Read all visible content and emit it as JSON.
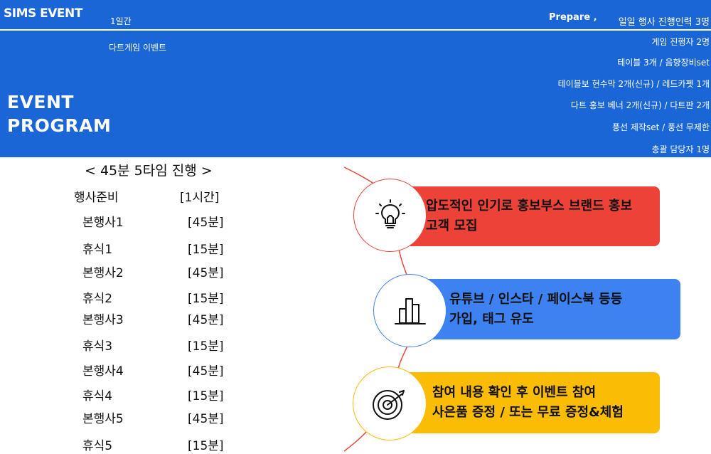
{
  "header": {
    "logo": "SIMS EVENT",
    "duration": "1일간",
    "event_name": "다트게임 이벤트",
    "prepare_label": "Prepare ,",
    "prep_items": [
      "일일 행사 진행인력 3명",
      "게임 진행자 2명",
      "테이블 3개 / 음향장비set",
      "테이블보 현수막 2개(신규) / 레드카펫 1개",
      "다트 홍보 베너 2개(신규) / 다트판 2개",
      "풍선 제작set / 풍선 무제한",
      "총괄 담당자 1명"
    ],
    "title_line1": "EVENT",
    "title_line2": "PROGRAM"
  },
  "schedule": {
    "title": "< 45분 5타임 진행 >",
    "rows": [
      {
        "name": "행사준비",
        "time": "[1시간]"
      },
      {
        "name": "본행사1",
        "time": "[45분]"
      },
      {
        "name": "휴식1",
        "time": "[15분]"
      },
      {
        "name": "본행사2",
        "time": "[45분]"
      },
      {
        "name": "휴식2",
        "time": "[15분]"
      },
      {
        "name": "본행사3",
        "time": "[45분]"
      },
      {
        "name": "휴식3",
        "time": "[15분]"
      },
      {
        "name": "본행사4",
        "time": "[45분]"
      },
      {
        "name": "휴식4",
        "time": "[15분]"
      },
      {
        "name": "본행사5",
        "time": "[45분]"
      },
      {
        "name": "휴식5",
        "time": "[15분]"
      }
    ]
  },
  "steps": [
    {
      "icon": "lightbulb-icon",
      "line1": "압도적인 인기로 홍보부스 브랜드 홍보",
      "line2": "고객 모집",
      "color": "#ec4238"
    },
    {
      "icon": "bar-chart-icon",
      "line1": "유튜브 / 인스타 / 페이스북 등등",
      "line2": "가입, 태그 유도",
      "color": "#3e82f2"
    },
    {
      "icon": "target-icon",
      "line1": "참여 내용 확인 후 이벤트 참여",
      "line2": "사은품 증정 / 또는 무료 증정&체험",
      "color": "#fbbc05"
    }
  ],
  "colors": {
    "header_bg": "#1a66d6",
    "curve": "#e8473b"
  }
}
